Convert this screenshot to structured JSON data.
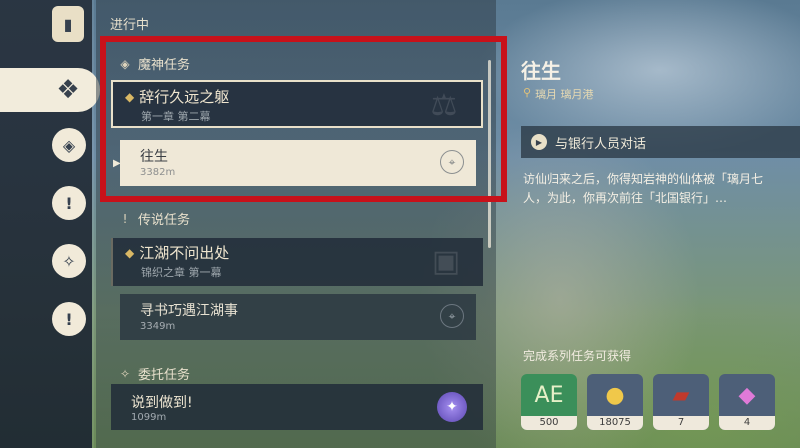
{
  "list": {
    "in_progress_label": "进行中",
    "archon": {
      "header": "魔神任务",
      "quest_title": "辞行久远之躯",
      "quest_sub": "第一章 第二幕",
      "step_name": "往生",
      "step_dist": "3382m"
    },
    "legend": {
      "header": "传说任务",
      "quest_title": "江湖不问出处",
      "quest_sub": "锦织之章 第一幕",
      "step_name": "寻书巧遇江湖事",
      "step_dist": "3349m"
    },
    "commission": {
      "header": "委托任务",
      "name": "说到做到!",
      "dist": "1099m"
    }
  },
  "detail": {
    "title": "往生",
    "location": "璃月 璃月港",
    "objective": "与银行人员对话",
    "description": "访仙归来之后，你得知岩神的仙体被「璃月七\n人，为此，你再次前往「北国银行」…",
    "rewards_title": "完成系列任务可获得",
    "rewards": [
      {
        "icon": "adventure-exp-icon",
        "count": "500",
        "color": "#3b8f5a"
      },
      {
        "icon": "mora-coin-icon",
        "count": "18075",
        "color": "#4d5f78"
      },
      {
        "icon": "book-icon",
        "count": "7",
        "color": "#4d5f78"
      },
      {
        "icon": "crystal-icon",
        "count": "4",
        "color": "#4d5f78"
      }
    ]
  },
  "colors": {
    "highlight": "#c8111a",
    "active_card": "#efe8d7"
  }
}
